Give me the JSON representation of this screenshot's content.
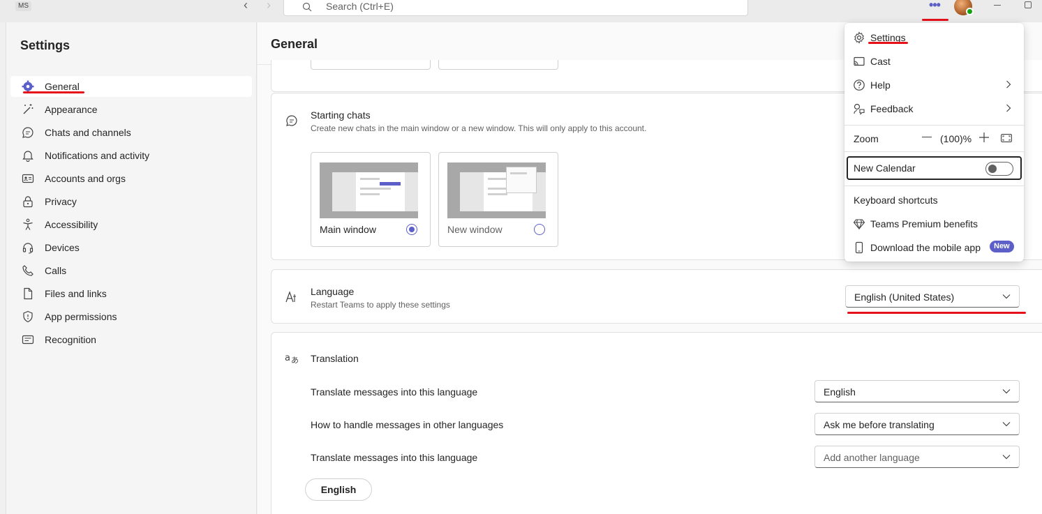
{
  "titlebar": {
    "badge": "MS",
    "search_placeholder": "Search (Ctrl+E)",
    "more_label": "•••"
  },
  "sidebar": {
    "title": "Settings",
    "items": [
      {
        "label": "General",
        "icon": "gear-icon",
        "active": true
      },
      {
        "label": "Appearance",
        "icon": "wand-icon"
      },
      {
        "label": "Chats and channels",
        "icon": "chat-icon"
      },
      {
        "label": "Notifications and activity",
        "icon": "bell-icon"
      },
      {
        "label": "Accounts and orgs",
        "icon": "id-card-icon"
      },
      {
        "label": "Privacy",
        "icon": "lock-icon"
      },
      {
        "label": "Accessibility",
        "icon": "accessibility-icon"
      },
      {
        "label": "Devices",
        "icon": "headset-icon"
      },
      {
        "label": "Calls",
        "icon": "phone-icon"
      },
      {
        "label": "Files and links",
        "icon": "document-icon"
      },
      {
        "label": "App permissions",
        "icon": "shield-icon"
      },
      {
        "label": "Recognition",
        "icon": "recognition-icon"
      }
    ]
  },
  "main": {
    "title": "General",
    "starting_chats": {
      "title": "Starting chats",
      "description": "Create new chats in the main window or a new window. This will only apply to this account.",
      "options": [
        {
          "label": "Main window",
          "selected": true
        },
        {
          "label": "New window",
          "selected": false
        }
      ]
    },
    "language": {
      "title": "Language",
      "description": "Restart Teams to apply these settings",
      "value": "English (United States)"
    },
    "translation": {
      "title": "Translation",
      "rows": [
        {
          "label": "Translate messages into this language",
          "value": "English"
        },
        {
          "label": "How to handle messages in other languages",
          "value": "Ask me before translating"
        },
        {
          "label": "Translate messages into this language",
          "placeholder": "Add another language"
        }
      ],
      "chip": "English"
    }
  },
  "menu": {
    "items": [
      {
        "label": "Settings",
        "icon": "gear-icon"
      },
      {
        "label": "Cast",
        "icon": "cast-icon"
      },
      {
        "label": "Help",
        "icon": "help-icon",
        "submenu": true
      },
      {
        "label": "Feedback",
        "icon": "feedback-icon",
        "submenu": true
      }
    ],
    "zoom": {
      "label": "Zoom",
      "value": "(100)%"
    },
    "new_calendar": {
      "label": "New Calendar",
      "enabled": false
    },
    "keyboard_shortcuts": "Keyboard shortcuts",
    "premium": "Teams Premium benefits",
    "mobile_app": "Download the mobile app",
    "new_badge": "New"
  },
  "colors": {
    "accent": "#5b5fc7",
    "annotation": "#e5101a"
  }
}
